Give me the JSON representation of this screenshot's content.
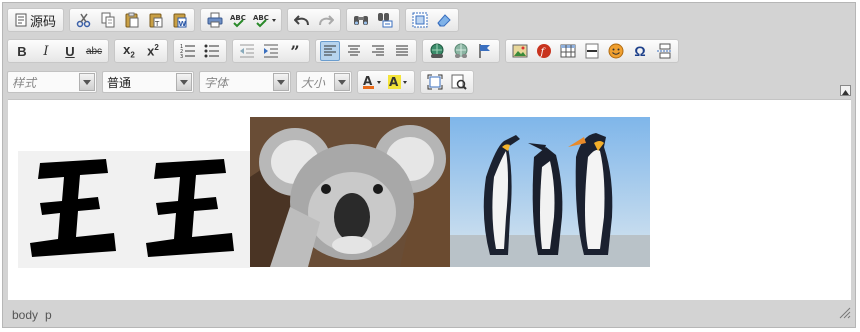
{
  "toolbar": {
    "source_label": "源码",
    "style_combo": "样式",
    "format_combo": "普通",
    "font_combo": "字体",
    "size_combo": "大小"
  },
  "status": {
    "path": [
      "body",
      "p"
    ]
  },
  "content": {
    "calligraphy_text": "王王",
    "images": [
      "koala",
      "penguins"
    ]
  },
  "colors": {
    "toolbar_bg": "#d3d3d3",
    "active_button": "#b7d4ee"
  }
}
